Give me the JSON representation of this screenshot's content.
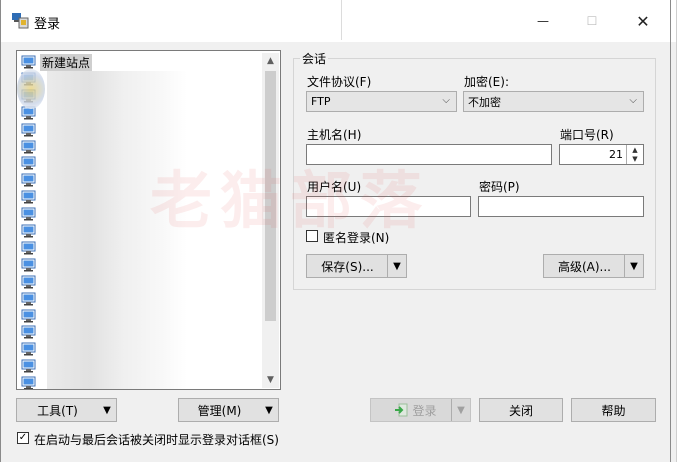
{
  "window": {
    "title": "登录",
    "minimize": "—",
    "maximize": "☐",
    "close": "✕"
  },
  "site_list": {
    "selected_item": "新建站点",
    "scroll_up": "▲",
    "scroll_down": "▼"
  },
  "session": {
    "caption": "会话",
    "protocol_label": "文件协议(F)",
    "protocol_value": "FTP",
    "encryption_label": "加密(E):",
    "encryption_value": "不加密",
    "host_label": "主机名(H)",
    "host_value": "",
    "port_label": "端口号(R)",
    "port_value": "21",
    "user_label": "用户名(U)",
    "user_value": "",
    "password_label": "密码(P)",
    "password_value": "",
    "anonymous_label": "匿名登录(N)",
    "anonymous_checked": false,
    "save_label": "保存(S)...",
    "advanced_label": "高级(A)..."
  },
  "bottom": {
    "tools_label": "工具(T)",
    "manage_label": "管理(M)",
    "login_label": "登录",
    "close_label": "关闭",
    "help_label": "帮助",
    "startup_label": "在启动与最后会话被关闭时显示登录对话框(S)",
    "startup_checked": true
  },
  "watermark": "老猫部落",
  "colors": {
    "accent": "#0078d7",
    "login_icon": "#3aa84a"
  }
}
